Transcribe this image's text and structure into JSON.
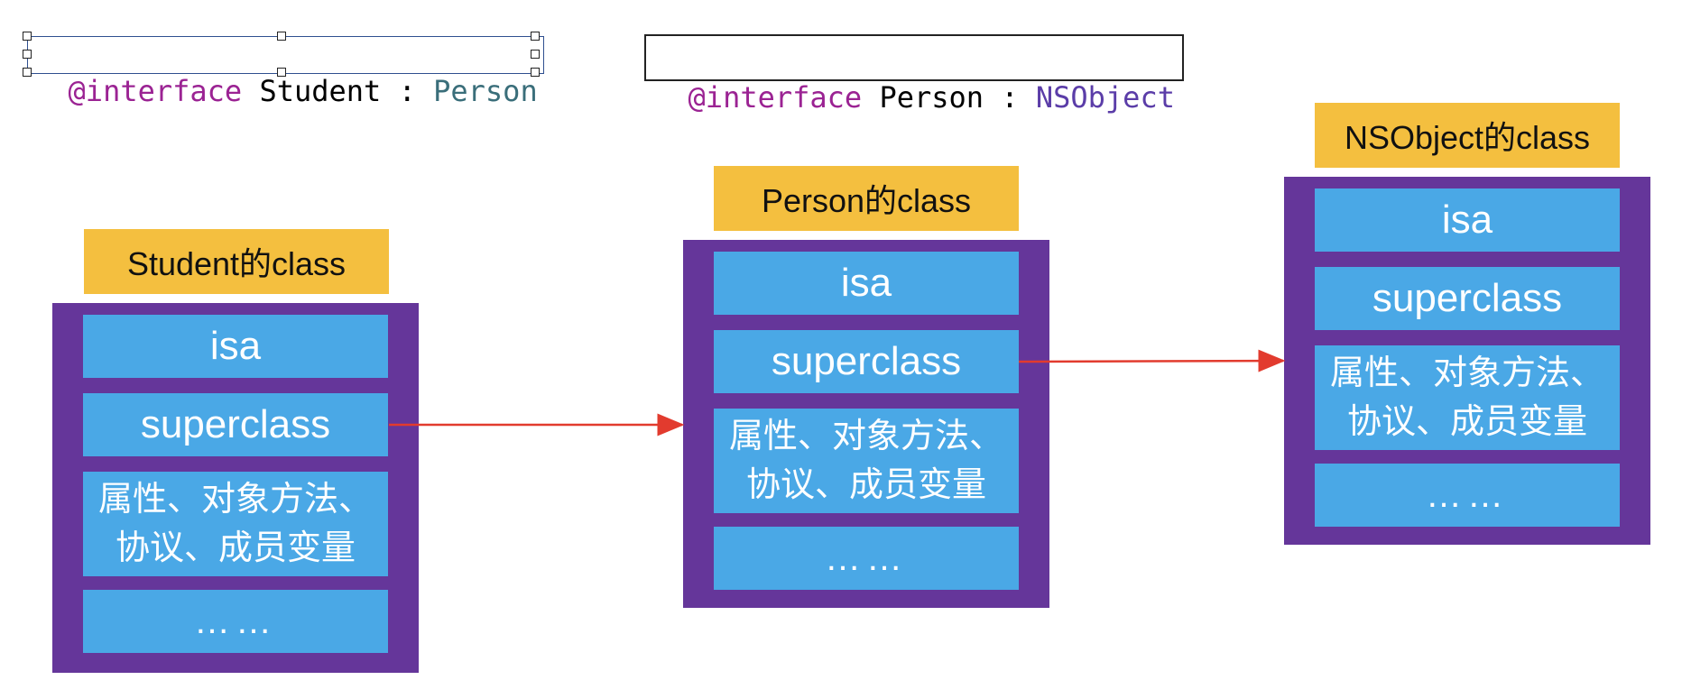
{
  "code": {
    "student": {
      "keyword": "@interface",
      "name": "Student",
      "colon": ":",
      "parent": "Person"
    },
    "person": {
      "keyword": "@interface",
      "name": "Person",
      "colon": ":",
      "parent": "NSObject"
    }
  },
  "classes": [
    {
      "title": "Student的class",
      "isa": "isa",
      "superclass": "superclass",
      "members_line1": "属性、对象方法、",
      "members_line2": "协议、成员变量",
      "more": "……"
    },
    {
      "title": "Person的class",
      "isa": "isa",
      "superclass": "superclass",
      "members_line1": "属性、对象方法、",
      "members_line2": "协议、成员变量",
      "more": "……"
    },
    {
      "title": "NSObject的class",
      "isa": "isa",
      "superclass": "superclass",
      "members_line1": "属性、对象方法、",
      "members_line2": "协议、成员变量",
      "more": "……"
    }
  ],
  "colors": {
    "title_bg": "#f4bf3f",
    "frame": "#65369a",
    "cell": "#4aa8e6",
    "arrow": "#e23b2e"
  }
}
